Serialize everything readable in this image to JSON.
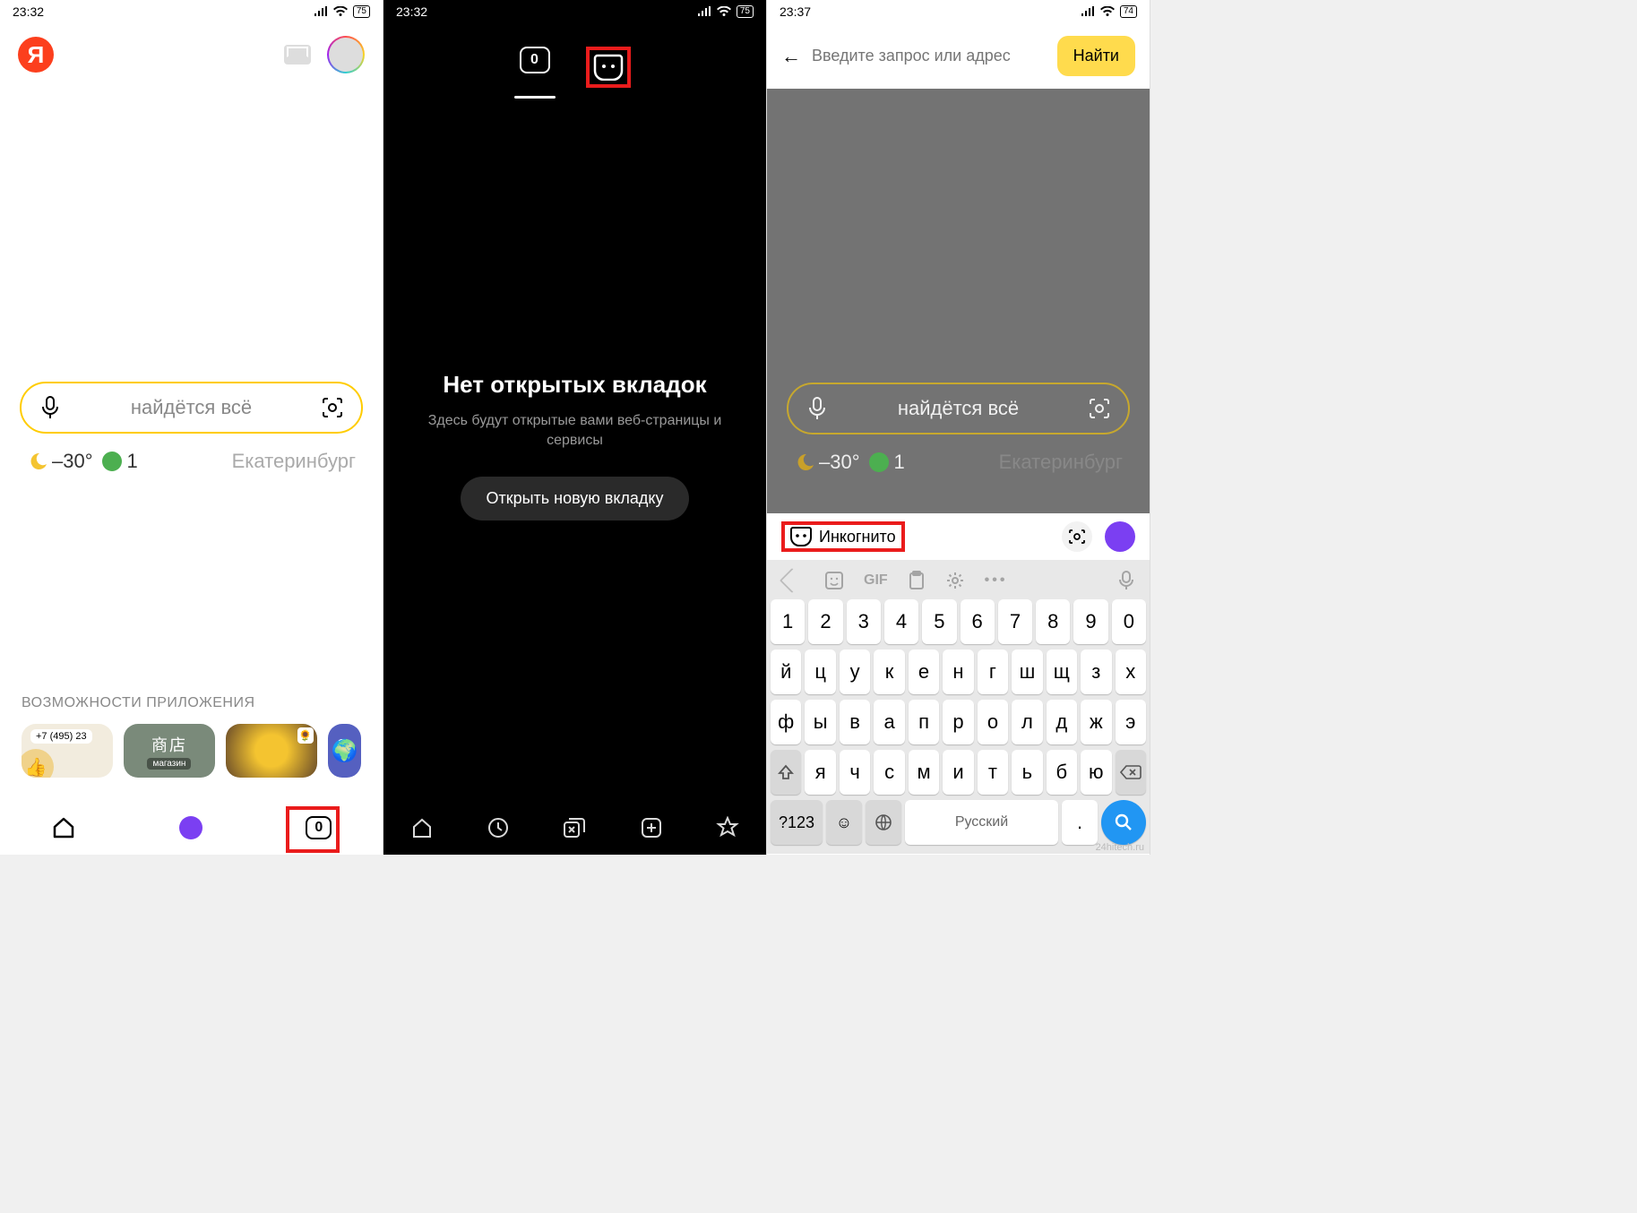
{
  "phone1": {
    "status": {
      "time": "23:32",
      "battery": "75"
    },
    "logo": "Я",
    "search_placeholder": "найдётся всё",
    "weather": {
      "temp": "–30°",
      "covid": "1",
      "city": "Екатеринбург"
    },
    "section_title": "ВОЗМОЖНОСТИ ПРИЛОЖЕНИЯ",
    "card1_phone": "+7 (495) 23",
    "card2_chars": "商店",
    "card2_tag": "магазин",
    "nav_tab_count": "0"
  },
  "phone2": {
    "status": {
      "time": "23:32",
      "battery": "75"
    },
    "tab_count": "0",
    "no_tabs_title": "Нет открытых вкладок",
    "no_tabs_sub": "Здесь будут открытые вами веб-страницы и сервисы",
    "open_tab": "Открыть новую вкладку"
  },
  "phone3": {
    "status": {
      "time": "23:37",
      "battery": "74"
    },
    "input_placeholder": "Введите запрос или адрес",
    "find": "Найти",
    "dim_search_placeholder": "найдётся всё",
    "dim_weather": {
      "temp": "–30°",
      "covid": "1",
      "city": "Екатеринбург"
    },
    "incognito_label": "Инкогнито",
    "kb_toolbar_gif": "GIF",
    "kb_rows": {
      "r1": [
        "1",
        "2",
        "3",
        "4",
        "5",
        "6",
        "7",
        "8",
        "9",
        "0"
      ],
      "r2": [
        "й",
        "ц",
        "у",
        "к",
        "е",
        "н",
        "г",
        "ш",
        "щ",
        "з",
        "х"
      ],
      "r3": [
        "ф",
        "ы",
        "в",
        "а",
        "п",
        "р",
        "о",
        "л",
        "д",
        "ж",
        "э"
      ],
      "r4_mid": [
        "я",
        "ч",
        "с",
        "м",
        "и",
        "т",
        "ь",
        "б",
        "ю"
      ]
    },
    "kb_symbols": "?123",
    "kb_space": "Русский",
    "kb_dot": "."
  },
  "watermark": "24hitech.ru"
}
